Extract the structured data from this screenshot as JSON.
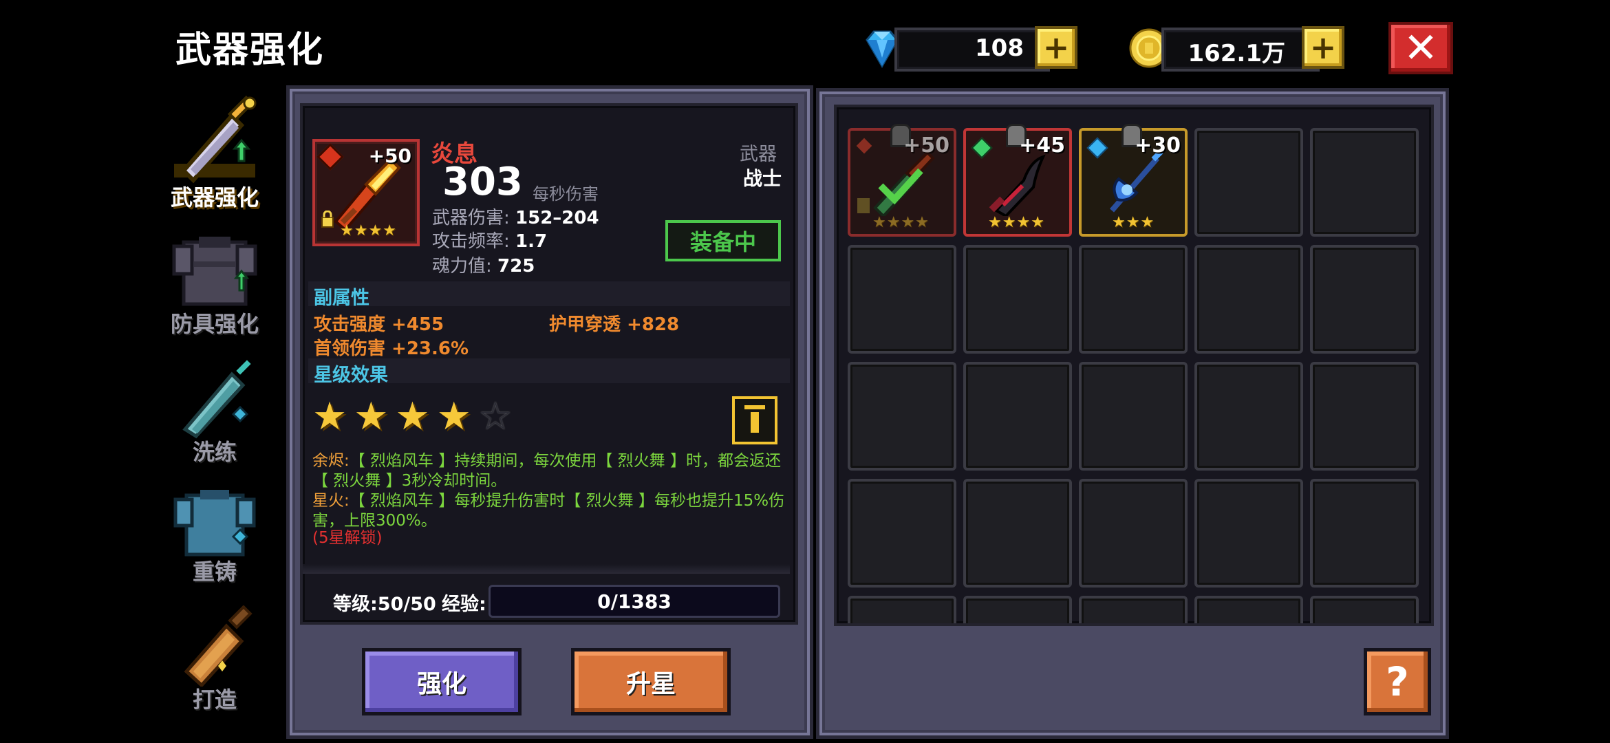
{
  "title": "武器强化",
  "currency": {
    "gems": "108",
    "gold": "162.1万",
    "plus": "+",
    "close": "✕"
  },
  "nav": [
    {
      "label": "武器强化",
      "active": true
    },
    {
      "label": "防具强化",
      "active": false
    },
    {
      "label": "洗练",
      "active": false
    },
    {
      "label": "重铸",
      "active": false
    },
    {
      "label": "打造",
      "active": false
    }
  ],
  "weapon": {
    "level_badge": "+50",
    "stars": "★★★★",
    "name": "炎息",
    "dps": "303",
    "dps_label": "每秒伤害",
    "type_category": "武器",
    "type_class": "战士",
    "stats": [
      {
        "label": "武器伤害: ",
        "value": "152–204"
      },
      {
        "label": "攻击频率: ",
        "value": "1.7"
      },
      {
        "label": "魂力值: ",
        "value": "725"
      }
    ],
    "equipped_label": "装备中"
  },
  "secondary": {
    "heading": "副属性",
    "attrs": [
      "攻击强度 +455",
      "护甲穿透 +828",
      "首领伤害 +23.6%"
    ]
  },
  "star_effect": {
    "heading": "星级效果",
    "filled": 4,
    "total": 5,
    "desc1_name": "余烬:",
    "desc1_text": "【 烈焰风车 】持续期间，每次使用【 烈火舞 】时，都会返还【 烈火舞 】3秒冷却时间。",
    "desc2_name": "星火:",
    "desc2_text": "【 烈焰风车 】每秒提升伤害时【 烈火舞 】每秒也提升15%伤害，上限300%。",
    "lock_text": "(5星解锁)"
  },
  "level": {
    "text": "等级:50/50",
    "exp_label": "经验:",
    "exp_value": "0/1383"
  },
  "buttons": {
    "enhance": "强化",
    "star_up": "升星",
    "help": "?"
  },
  "inventory": [
    {
      "level": "+50",
      "stars": "★★★★",
      "rarity": "red",
      "equipped": true
    },
    {
      "level": "+45",
      "stars": "★★★★",
      "rarity": "red",
      "equipped": false
    },
    {
      "level": "+30",
      "stars": "★★★",
      "rarity": "gold",
      "equipped": false
    }
  ],
  "colors": {
    "accent_red": "#e8483c",
    "accent_cyan": "#4cc6e6",
    "accent_orange": "#f08a2e",
    "accent_green": "#7cd63e",
    "gold": "#f3d24a"
  }
}
